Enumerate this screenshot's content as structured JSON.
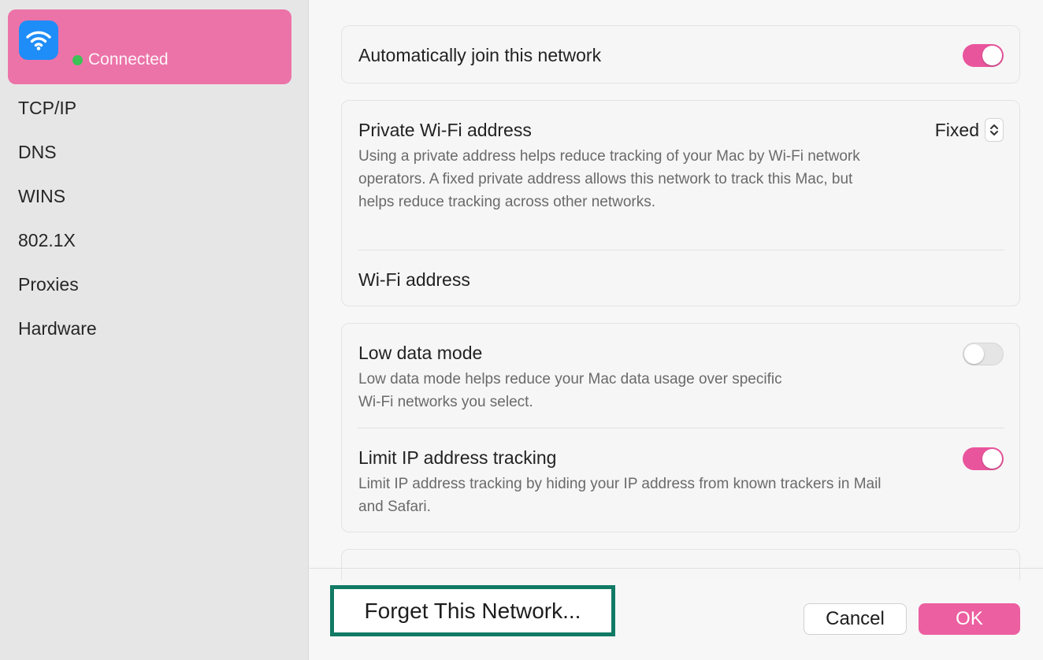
{
  "colors": {
    "accent": "#ec5fa0",
    "selection": "#ec73a8",
    "wifi_tile": "#1f8df8",
    "connected_dot": "#2ec94f",
    "highlight_border": "#117a65"
  },
  "sidebar": {
    "network": {
      "icon": "wifi-icon",
      "status": "Connected"
    },
    "items": [
      {
        "label": "TCP/IP"
      },
      {
        "label": "DNS"
      },
      {
        "label": "WINS"
      },
      {
        "label": "802.1X"
      },
      {
        "label": "Proxies"
      },
      {
        "label": "Hardware"
      }
    ]
  },
  "settings": {
    "auto_join": {
      "label": "Automatically join this network",
      "enabled": true
    },
    "private_address": {
      "label": "Private Wi-Fi address",
      "value": "Fixed",
      "description": "Using a private address helps reduce tracking of your Mac by Wi-Fi network operators. A fixed private address allows this network to track this Mac, but helps reduce tracking across other networks."
    },
    "wifi_address": {
      "label": "Wi-Fi address"
    },
    "low_data": {
      "label": "Low data mode",
      "enabled": false,
      "description": "Low data mode helps reduce your Mac data usage over specific Wi-Fi networks you select."
    },
    "limit_ip": {
      "label": "Limit IP address tracking",
      "enabled": true,
      "description": "Limit IP address tracking by hiding your IP address from known trackers in Mail and Safari."
    }
  },
  "footer": {
    "forget_label": "Forget This Network...",
    "cancel_label": "Cancel",
    "ok_label": "OK"
  }
}
